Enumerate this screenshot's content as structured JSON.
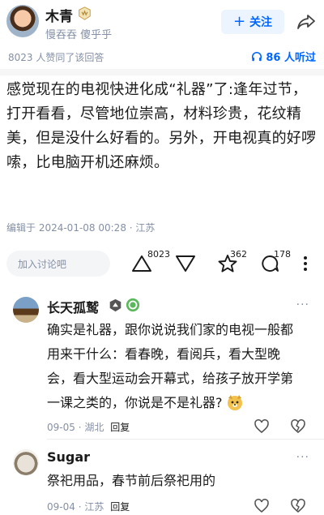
{
  "author": {
    "name": "木青",
    "bio": "慢吞吞 傻乎乎",
    "follow_label": "关注"
  },
  "meta": {
    "likes_text": "8023 人赞同了该回答",
    "listen_text": "86 人听过"
  },
  "answer": {
    "text": "感觉现在的电视快进化成“礼器”了:逢年过节，打开看看，尽管地位崇高，材料珍贵，花纹精美，但是没什么好看的。另外，开电视真的好啰嗦，比电脑开机还麻烦。",
    "edit_info": "编辑于 2024-01-08 00:28 · 江苏"
  },
  "actions": {
    "discuss_placeholder": "加入讨论吧",
    "upvote_count": "8023",
    "favorite_count": "362",
    "comment_count": "178"
  },
  "comments": [
    {
      "name": "长天孤鹫",
      "text": "确实是礼器，跟你说说我们家的电视一般都用来干什么：看春晚，看阅兵，看大型晚会，看大型运动会开幕式，给孩子放开学第一课之类的，你说是不是礼器?",
      "date": "09-05",
      "location": "湖北",
      "reply_label": "回复",
      "more": "···"
    },
    {
      "name": "Sugar",
      "text": "祭祀用品，春节前后祭祀用的",
      "date": "09-04",
      "location": "江苏",
      "reply_label": "回复",
      "more": "···"
    }
  ],
  "colors": {
    "accent": "#0066ff",
    "muted": "#8590a6"
  },
  "icons": [
    "vip-badge-icon",
    "share-icon",
    "headphones-icon",
    "upvote-icon",
    "downvote-icon",
    "star-icon",
    "comment-icon",
    "more-vertical-icon",
    "heart-icon",
    "broken-heart-icon",
    "level-badge-icon",
    "emoji-dog-icon"
  ]
}
